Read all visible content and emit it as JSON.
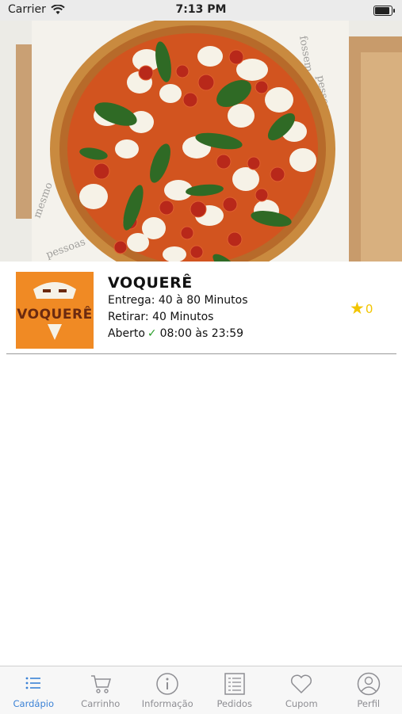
{
  "status_bar": {
    "carrier": "Carrier",
    "time": "7:13 PM"
  },
  "hero": {
    "image": "margherita-pizza-photo"
  },
  "store": {
    "logo_text": "VOQUERÊ",
    "name": "VOQUERÊ",
    "delivery": "Entrega: 40 à 80 Minutos",
    "pickup": "Retirar: 40 Minutos",
    "open_label": "Aberto",
    "hours": "08:00 às 23:59",
    "rating": "0",
    "colors": {
      "logo_bg": "#f08a24",
      "star": "#f2c500",
      "open_check": "#2a9d2a"
    }
  },
  "tabs": [
    {
      "label": "Cardápio",
      "icon": "menu-list-icon",
      "active": true
    },
    {
      "label": "Carrinho",
      "icon": "cart-icon",
      "active": false
    },
    {
      "label": "Informação",
      "icon": "info-icon",
      "active": false
    },
    {
      "label": "Pedidos",
      "icon": "orders-icon",
      "active": false
    },
    {
      "label": "Cupom",
      "icon": "heart-icon",
      "active": false
    },
    {
      "label": "Perfil",
      "icon": "profile-icon",
      "active": false
    }
  ],
  "accent_color": "#3b82d6"
}
